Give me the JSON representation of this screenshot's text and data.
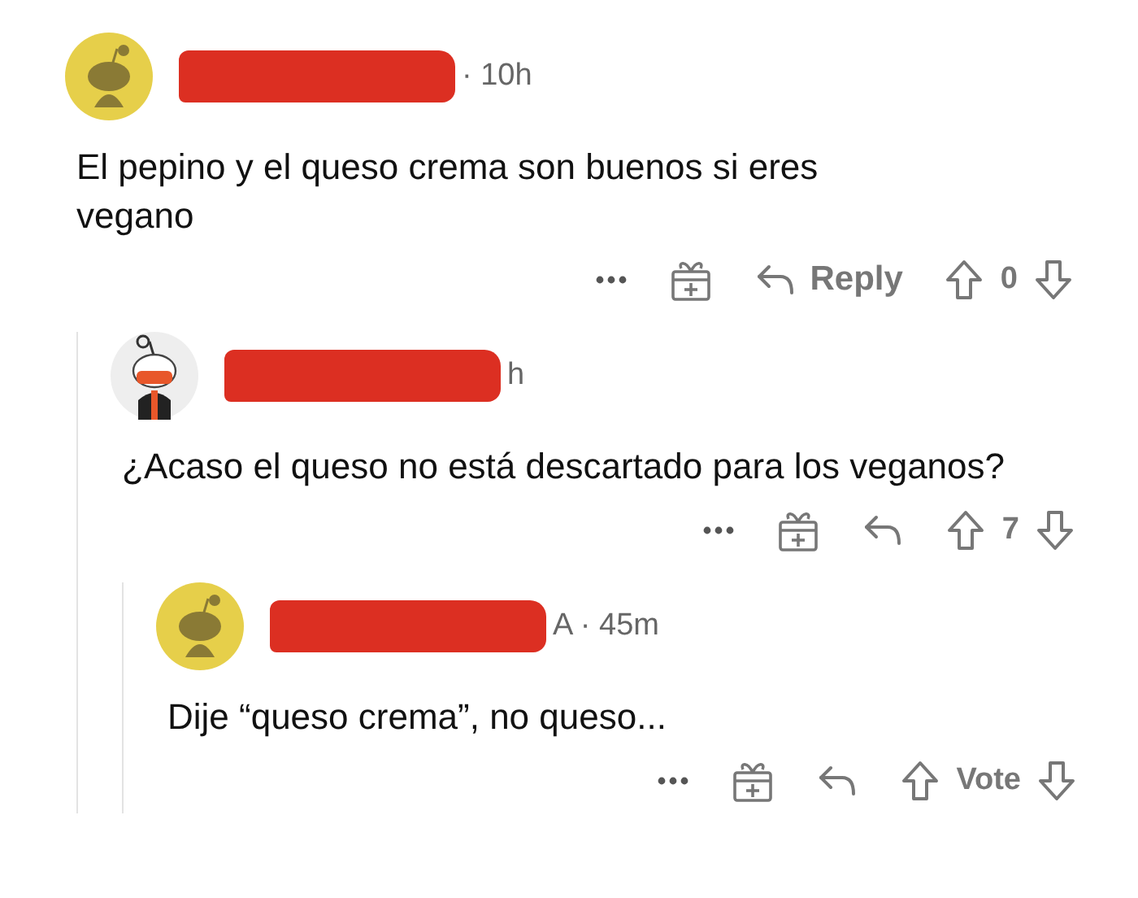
{
  "comments": [
    {
      "avatar": {
        "kind": "plain",
        "color": "#e6cf4a"
      },
      "redacted": true,
      "meta": "· 10h",
      "body": "El pepino y el queso crema son buenos si eres vegano",
      "actions": {
        "reply_label": "Reply",
        "score": "0"
      },
      "children": [
        {
          "avatar": {
            "kind": "costume",
            "color": "#eeeeee"
          },
          "redacted": true,
          "meta": "h",
          "body": "¿Acaso el queso no está descartado para los veganos?",
          "actions": {
            "score": "7"
          },
          "children": [
            {
              "avatar": {
                "kind": "plain",
                "color": "#e6cf4a"
              },
              "redacted": true,
              "meta": "A · 45m",
              "body": "Dije “queso crema”, no queso...",
              "actions": {
                "score": "Vote"
              }
            }
          ]
        }
      ]
    }
  ]
}
